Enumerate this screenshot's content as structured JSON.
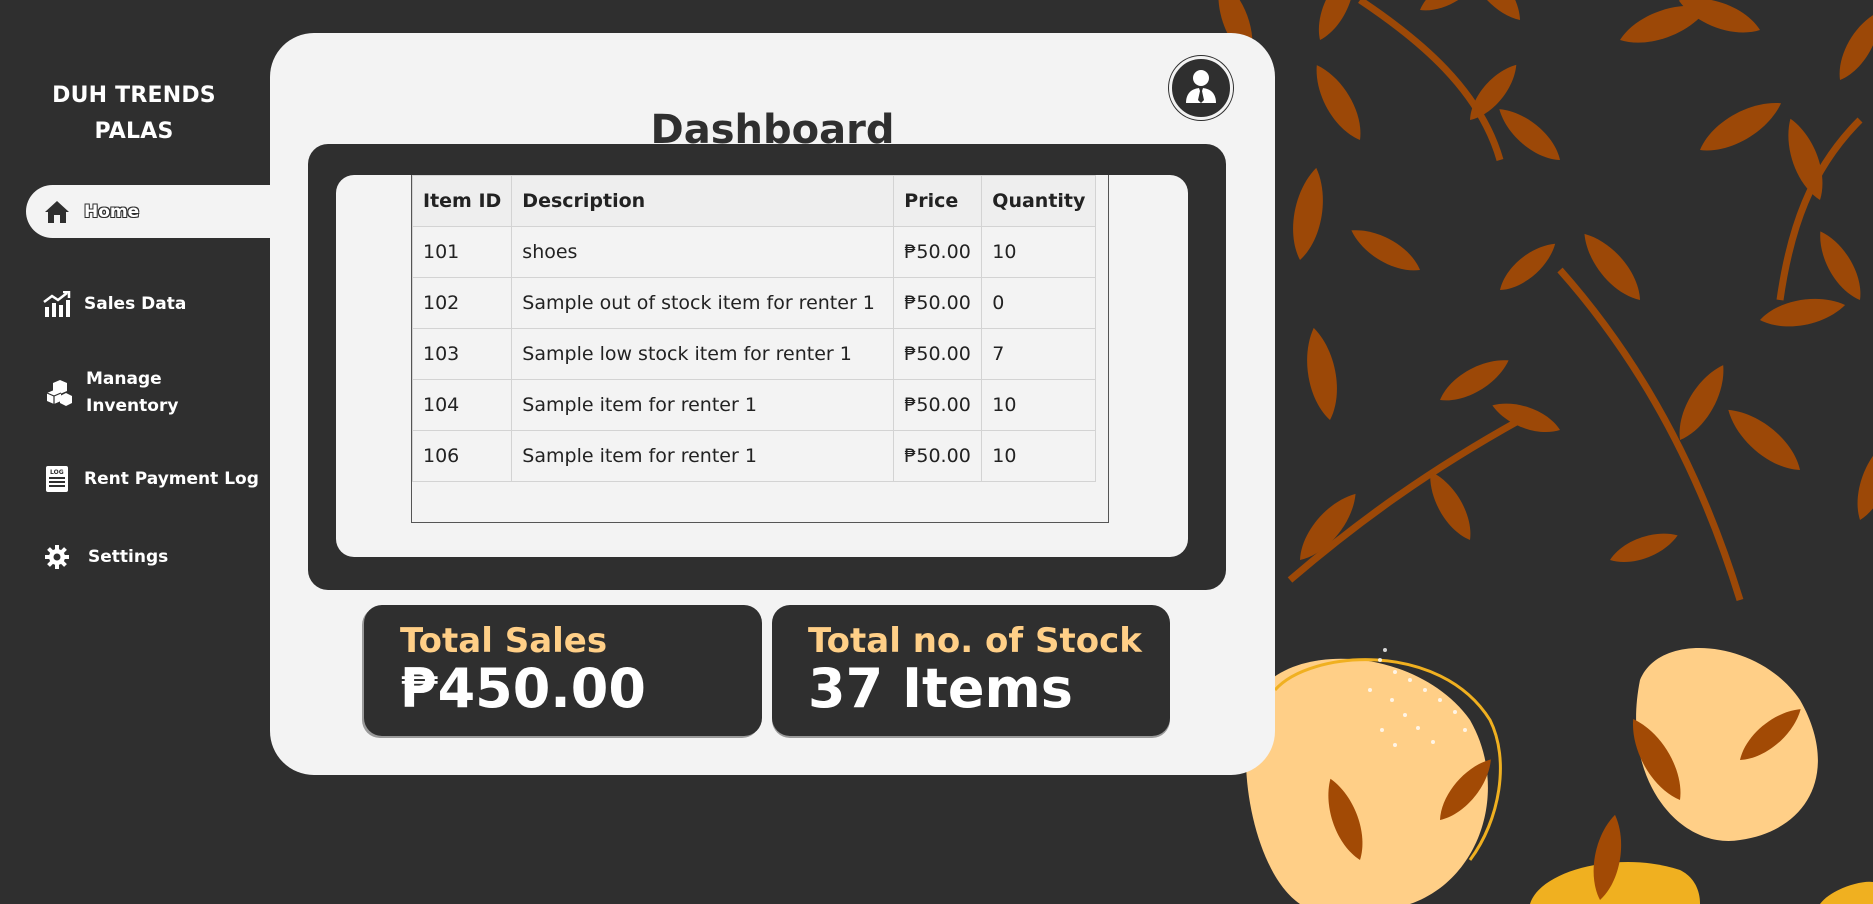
{
  "brand": {
    "line1": "DUH TRENDS",
    "line2": "PALAS"
  },
  "sidebar": {
    "items": [
      {
        "label": "Home",
        "icon": "home-icon",
        "active": true
      },
      {
        "label": "Sales Data",
        "icon": "chart-icon"
      },
      {
        "label_line1": "Manage",
        "label_line2": "Inventory",
        "icon": "boxes-icon"
      },
      {
        "label": "Rent Payment Log",
        "icon": "log-icon"
      },
      {
        "label": "Settings",
        "icon": "gear-icon"
      }
    ]
  },
  "header": {
    "title": "Dashboard",
    "avatar_icon": "user-avatar-icon"
  },
  "table": {
    "columns": [
      "Item ID",
      "Description",
      "Price",
      "Quantity"
    ],
    "rows": [
      [
        "101",
        "shoes",
        "₱50.00",
        "10"
      ],
      [
        "102",
        "Sample out of stock item for renter 1",
        "₱50.00",
        "0"
      ],
      [
        "103",
        "Sample low stock item for renter 1",
        "₱50.00",
        "7"
      ],
      [
        "104",
        "Sample item for renter 1",
        "₱50.00",
        "10"
      ],
      [
        "106",
        "Sample item for renter 1",
        "₱50.00",
        "10"
      ]
    ]
  },
  "stats": {
    "total_sales": {
      "label": "Total Sales",
      "value": "₱450.00"
    },
    "total_stock": {
      "label": "Total no. of Stock",
      "value": "37 Items"
    }
  },
  "colors": {
    "background": "#2f2f2f",
    "panel": "#f3f3f3",
    "accent": "#ffcf87",
    "leaf": "#a24a05",
    "peach": "#ffcf87",
    "gold": "#f0b020"
  }
}
